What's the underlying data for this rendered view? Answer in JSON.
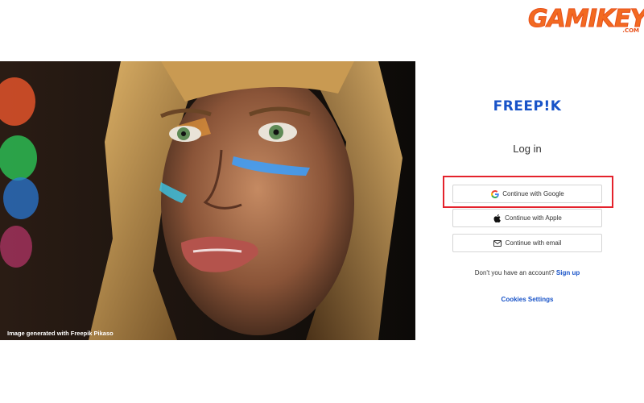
{
  "watermark": {
    "logo_text": "GAMIKEY",
    "logo_suffix": ".COM"
  },
  "hero": {
    "caption": "Image generated with Freepik Pikaso"
  },
  "login": {
    "brand": "FREEP!K",
    "title": "Log in",
    "google_label": "Continue with Google",
    "apple_label": "Continue with Apple",
    "email_label": "Continue with email",
    "no_account_text": "Don't you have an account?",
    "signup_link": "Sign up",
    "cookies_link": "Cookies Settings"
  },
  "colors": {
    "brand_blue": "#1853c8",
    "highlight_red": "#e4222c",
    "watermark_orange": "#f26a21"
  },
  "icons": {
    "google": "google-g-icon",
    "apple": "apple-icon",
    "email": "mail-icon"
  }
}
